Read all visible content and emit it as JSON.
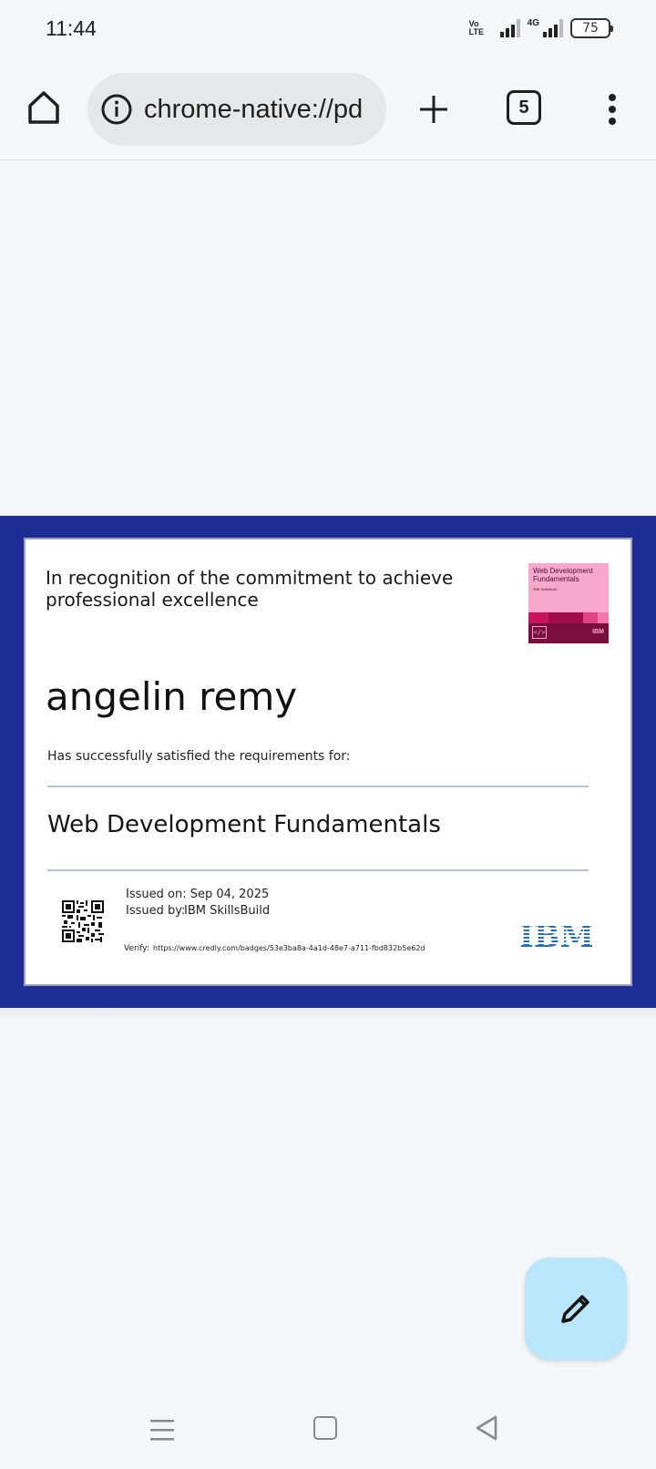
{
  "status_bar": {
    "time": "11:44",
    "volte_label": "VoLTE",
    "network_label": "4G",
    "battery": "75"
  },
  "toolbar": {
    "url": "chrome-native://pd",
    "tab_count": "5",
    "icons": {
      "home": "home-icon",
      "info": "info-icon",
      "new_tab": "plus-icon",
      "menu": "more-vert-icon"
    }
  },
  "certificate": {
    "recognition": "In recognition of the commitment to achieve professional excellence",
    "name": "angelin remy",
    "requirement_text": "Has successfully satisfied the requirements for:",
    "course": "Web Development Fundamentals",
    "issued_on": "Issued on: Sep 04, 2025",
    "issued_by_label": "Issued by:",
    "issued_by": "IBM SkillsBuild",
    "verify_label": "Verify:",
    "verify_url": "https://www.credly.com/badges/53e3ba8a-4a1d-48e7-a711-fbd832b5e62d",
    "badge": {
      "title": "Web Development Fundamentals",
      "subtitle": "IBM SkillsBuild",
      "brand": "IBM",
      "background_color": "#f7a8cc"
    },
    "logo": "IBM",
    "band_color": "#1f2d96"
  },
  "fab": {
    "icon": "pencil-icon",
    "color": "#b8e6fa"
  },
  "nav_bar": {
    "icons": [
      "recents-menu-icon",
      "home-square-icon",
      "back-triangle-icon"
    ]
  }
}
